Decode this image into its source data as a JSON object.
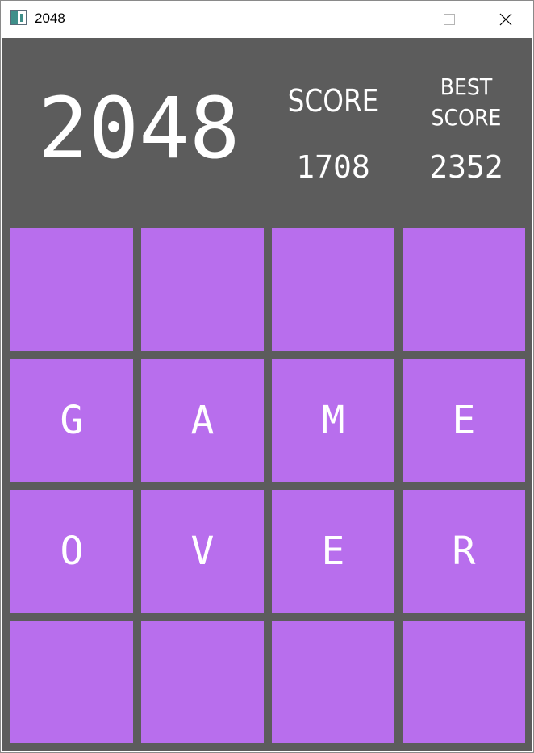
{
  "window": {
    "title": "2048",
    "icon": "app-window-icon",
    "controls": [
      "minimize-icon",
      "maximize-icon",
      "close-icon"
    ]
  },
  "game": {
    "title": "2048",
    "score_label": "SCORE",
    "score": "1708",
    "best_label_line1": "BEST",
    "best_label_line2": "SCORE",
    "best": "2352",
    "board": [
      [
        "",
        "",
        "",
        ""
      ],
      [
        "G",
        "A",
        "M",
        "E"
      ],
      [
        "O",
        "V",
        "E",
        "R"
      ],
      [
        "",
        "",
        "",
        ""
      ]
    ]
  },
  "colors": {
    "background": "#5c5c5c",
    "tile": "#b86eed",
    "text": "#ffffff"
  }
}
